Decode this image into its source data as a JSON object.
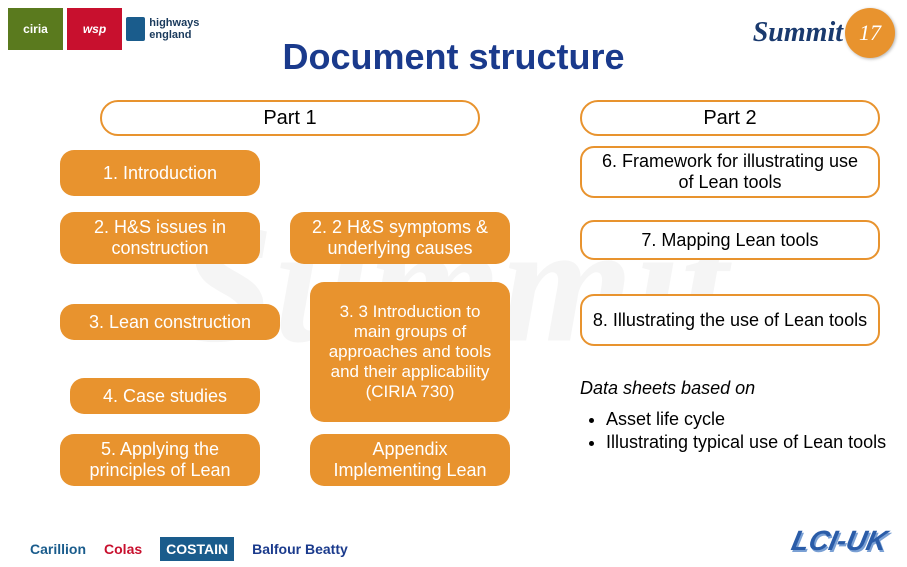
{
  "watermark": "Summit",
  "title": "Document structure",
  "logos": {
    "ciria": "ciria",
    "wsp": "wsp",
    "highways": "highways england",
    "summit_num": "17",
    "summit_text": "Summit",
    "carillion": "Carillion",
    "colas": "Colas",
    "costain": "COSTAIN",
    "balfour": "Balfour Beatty",
    "lci": "LCI-UK"
  },
  "part1": {
    "header": "Part 1",
    "box1": "1. Introduction",
    "box2": "2. H&S issues in construction",
    "box2b": "2. 2 H&S symptoms & underlying causes",
    "box3": "3. Lean construction",
    "box3b": "3. 3 Introduction to main groups of approaches and tools and their applicability (CIRIA 730)",
    "box4": "4. Case studies",
    "box5": "5. Applying the principles of Lean",
    "appendix": "Appendix Implementing Lean"
  },
  "part2": {
    "header": "Part 2",
    "box6": "6. Framework for illustrating use of Lean tools",
    "box7": "7. Mapping Lean tools",
    "box8": "8. Illustrating the use of Lean tools",
    "notes_title": "Data sheets based on",
    "bullets": [
      "Asset life cycle",
      "Illustrating typical use of Lean tools"
    ]
  }
}
